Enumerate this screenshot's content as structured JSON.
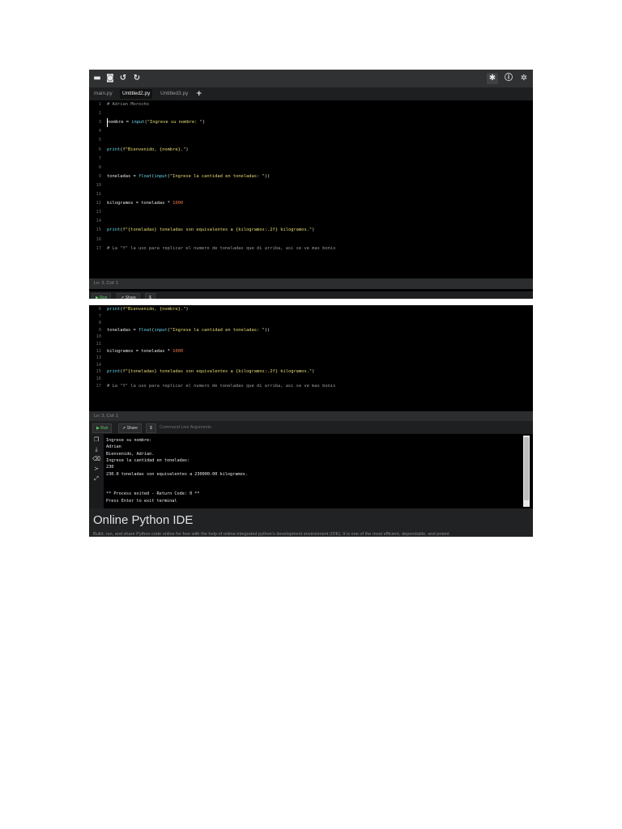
{
  "toolbar": {
    "left_icons": [
      "folder-icon",
      "save-icon",
      "undo-icon",
      "redo-icon"
    ],
    "right_icons": [
      "theme-icon",
      "info-icon",
      "settings-icon"
    ]
  },
  "tabs": [
    {
      "label": "main.py",
      "active": false
    },
    {
      "label": "Untitled2.py",
      "active": true
    },
    {
      "label": "Untitled3.py",
      "active": false
    }
  ],
  "tab_add": "+",
  "code_lines": [
    {
      "n": "1",
      "text": "# Adrian Morocho"
    },
    {
      "n": "2",
      "text": ""
    },
    {
      "n": "3",
      "text": "nombre = input(\"Ingrese su nombre: \")"
    },
    {
      "n": "4",
      "text": ""
    },
    {
      "n": "5",
      "text": ""
    },
    {
      "n": "6",
      "text": "print(f\"Bienvenido, {nombre}.\")"
    },
    {
      "n": "7",
      "text": ""
    },
    {
      "n": "8",
      "text": ""
    },
    {
      "n": "9",
      "text": "toneladas = float(input(\"Ingrese la cantidad en toneladas: \"))"
    },
    {
      "n": "10",
      "text": ""
    },
    {
      "n": "11",
      "text": ""
    },
    {
      "n": "12",
      "text": "kilogramos = toneladas * 1000"
    },
    {
      "n": "13",
      "text": ""
    },
    {
      "n": "14",
      "text": ""
    },
    {
      "n": "15",
      "text": "print(f\"{toneladas} toneladas son equivalentes a {kilogramos:.2f} kilogramos.\")"
    },
    {
      "n": "16",
      "text": ""
    },
    {
      "n": "17",
      "text": "# La \"f\" la uso para replicar el numero de toneladas que di arriba, asi se ve mas bonis"
    }
  ],
  "status": "Ln: 3, Col: 1",
  "runbar": {
    "run_label": "▶ Run",
    "share_label": "⇗ Share",
    "stdin_label": "$",
    "args_placeholder": "Command Line Arguments"
  },
  "terminal_icons": [
    "copy-icon",
    "download-icon",
    "clear-icon",
    "terminal-icon",
    "expand-icon"
  ],
  "terminal_lines": [
    "Ingrese su nombre:",
    "Adrian",
    "Bienvenido, Adrian.",
    "Ingrese la cantidad en toneladas:",
    "230",
    "230.0 toneladas son equivalentes a 230000.00 kilogramos.",
    "",
    "",
    "** Process exited - Return Code: 0 **",
    "Press Enter to exit terminal"
  ],
  "ide_heading": "Online Python IDE",
  "ide_paragraph": "Build, run, and share Python code online for free with the help of online-integrated python's development environment (IDE). It is one of the most efficient, dependable, and potent"
}
